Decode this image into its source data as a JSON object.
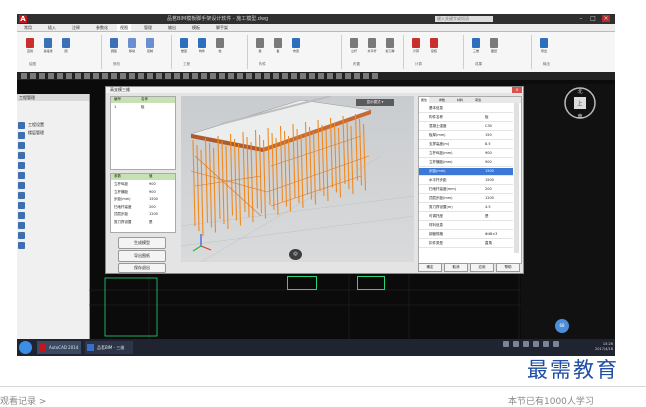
{
  "app": {
    "logo_letter": "A",
    "title": "品茗BIM模板脚手架设计软件 - 施工模型.dwg",
    "search_placeholder": "键入关键字或短语",
    "window_buttons": [
      "–",
      "□",
      "×"
    ]
  },
  "ribbon": {
    "tabs": [
      "常用",
      "插入",
      "注释",
      "参数化",
      "视图",
      "管理",
      "输出",
      "模板",
      "脚手架"
    ],
    "tools": [
      {
        "label": "直线",
        "color": "#c9302c"
      },
      {
        "label": "多段线",
        "color": "#3b6fb6"
      },
      {
        "label": "圆",
        "color": "#3b6fb6"
      },
      {
        "label": "圆弧",
        "color": "#3b6fb6"
      },
      {
        "label": "移动",
        "color": "#6a8fd1"
      },
      {
        "label": "复制",
        "color": "#6a8fd1"
      },
      {
        "label": "楼层",
        "color": "#2e6fbd"
      },
      {
        "label": "构件",
        "color": "#2e6fbd"
      },
      {
        "label": "柱",
        "color": "#7a7a7a"
      },
      {
        "label": "梁",
        "color": "#7a7a7a"
      },
      {
        "label": "板",
        "color": "#7a7a7a"
      },
      {
        "label": "布置",
        "color": "#2e6fbd"
      },
      {
        "label": "立杆",
        "color": "#7a7a7a"
      },
      {
        "label": "水平杆",
        "color": "#7a7a7a"
      },
      {
        "label": "剪刀撑",
        "color": "#7a7a7a"
      },
      {
        "label": "计算",
        "color": "#c9302c"
      },
      {
        "label": "复核",
        "color": "#c9302c"
      },
      {
        "label": "三维",
        "color": "#2e6fbd"
      },
      {
        "label": "图纸",
        "color": "#7a7a7a"
      },
      {
        "label": "导出",
        "color": "#2e6fbd"
      }
    ],
    "groups": [
      "绘图",
      "修改",
      "工程",
      "构件",
      "布置",
      "计算",
      "成果",
      "输出"
    ]
  },
  "left_panel": {
    "header": "工程管理",
    "tree": [
      "工程设置",
      "楼层管理"
    ]
  },
  "dialog": {
    "title": "高支模三维",
    "close": "×",
    "list_headers": [
      "编号",
      "名称"
    ],
    "list_rows": [
      [
        "1",
        "板"
      ]
    ],
    "param_headers": [
      "参数",
      "值"
    ],
    "param_rows": [
      [
        "立杆纵距",
        "900"
      ],
      [
        "立杆横距",
        "900"
      ],
      [
        "步距(mm)",
        "1500"
      ],
      [
        "扫地杆高度",
        "200"
      ],
      [
        "顶层步距",
        "1200"
      ],
      [
        "剪刀撑设置",
        "是"
      ]
    ],
    "buttons": [
      "生成模型",
      "导出图纸",
      "保存退出"
    ],
    "view_toolbar": "显示模式 ▾",
    "camera_icon_glyph": "◎",
    "prop_tabs": [
      "属性",
      "参数",
      "材料",
      "荷载"
    ],
    "prop_rows": [
      {
        "name": "基本信息",
        "value": ""
      },
      {
        "name": "构件名称",
        "value": "板"
      },
      {
        "name": "混凝土强度",
        "value": "C30"
      },
      {
        "name": "板厚(mm)",
        "value": "150"
      },
      {
        "name": "支撑高度(m)",
        "value": "8.5"
      },
      {
        "name": "立杆纵距(mm)",
        "value": "900"
      },
      {
        "name": "立杆横距(mm)",
        "value": "900"
      },
      {
        "name": "步距(mm)",
        "value": "1500"
      },
      {
        "name": "水平杆步距",
        "value": "1500"
      },
      {
        "name": "扫地杆高度(mm)",
        "value": "200"
      },
      {
        "name": "顶层步距(mm)",
        "value": "1200"
      },
      {
        "name": "剪刀撑设置(m)",
        "value": "4.5"
      },
      {
        "name": "可调托座",
        "value": "是"
      },
      {
        "name": "材料信息",
        "value": ""
      },
      {
        "name": "钢管规格",
        "value": "Φ48×3"
      },
      {
        "name": "扣件类型",
        "value": "直角"
      }
    ],
    "selected_prop_index": 7,
    "footer_buttons": [
      "确定",
      "取消",
      "应用",
      "帮助"
    ]
  },
  "compass": {
    "north": "北",
    "south": "南",
    "center": "上"
  },
  "badge": "68",
  "taskbar": {
    "tasks": [
      "AutoCAD 2014",
      "品茗BIM - 三维"
    ],
    "clock": [
      "15:26",
      "2017/4/18"
    ]
  },
  "watermark": "最需教育",
  "footer_left": "观看记录 >",
  "footer_right": "本节已有1000人学习"
}
